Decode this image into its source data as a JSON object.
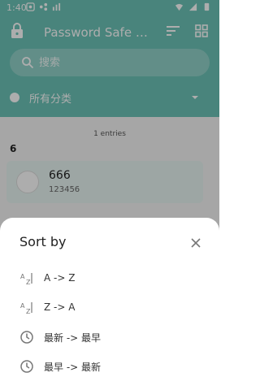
{
  "status_bar": {
    "time": "1:40"
  },
  "toolbar": {
    "title": "Password Safe 专业版"
  },
  "search": {
    "placeholder": "搜索"
  },
  "category": {
    "label": "所有分类"
  },
  "list": {
    "entries_count": "1 entries",
    "group_header": "6",
    "items": [
      {
        "name": "666",
        "subtitle": "123456"
      }
    ]
  },
  "sort_sheet": {
    "title": "Sort by",
    "options": [
      {
        "label": "A -> Z",
        "icon": "sort-alpha-icon"
      },
      {
        "label": "Z -> A",
        "icon": "sort-alpha-icon"
      },
      {
        "label": "最新 -> 最早",
        "icon": "clock-icon"
      },
      {
        "label": "最早 -> 最新",
        "icon": "clock-icon"
      }
    ]
  },
  "colors": {
    "accent": "#6cc3b7",
    "card": "#e8f5f2"
  }
}
